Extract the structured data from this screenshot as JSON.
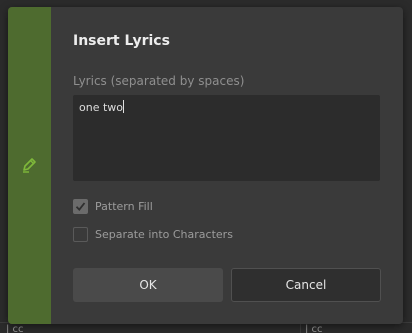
{
  "background": {
    "bottom_labels": [
      "| cc",
      "| cc"
    ]
  },
  "dialog": {
    "title": "Insert Lyrics",
    "accent_color": "#4e6b2f",
    "strip_icon": "pencil-icon",
    "lyrics_label": "Lyrics (separated by spaces)",
    "lyrics_value": "one two",
    "options": [
      {
        "label": "Pattern Fill",
        "checked": true
      },
      {
        "label": "Separate into Characters",
        "checked": false
      }
    ],
    "ok_label": "OK",
    "cancel_label": "Cancel"
  }
}
